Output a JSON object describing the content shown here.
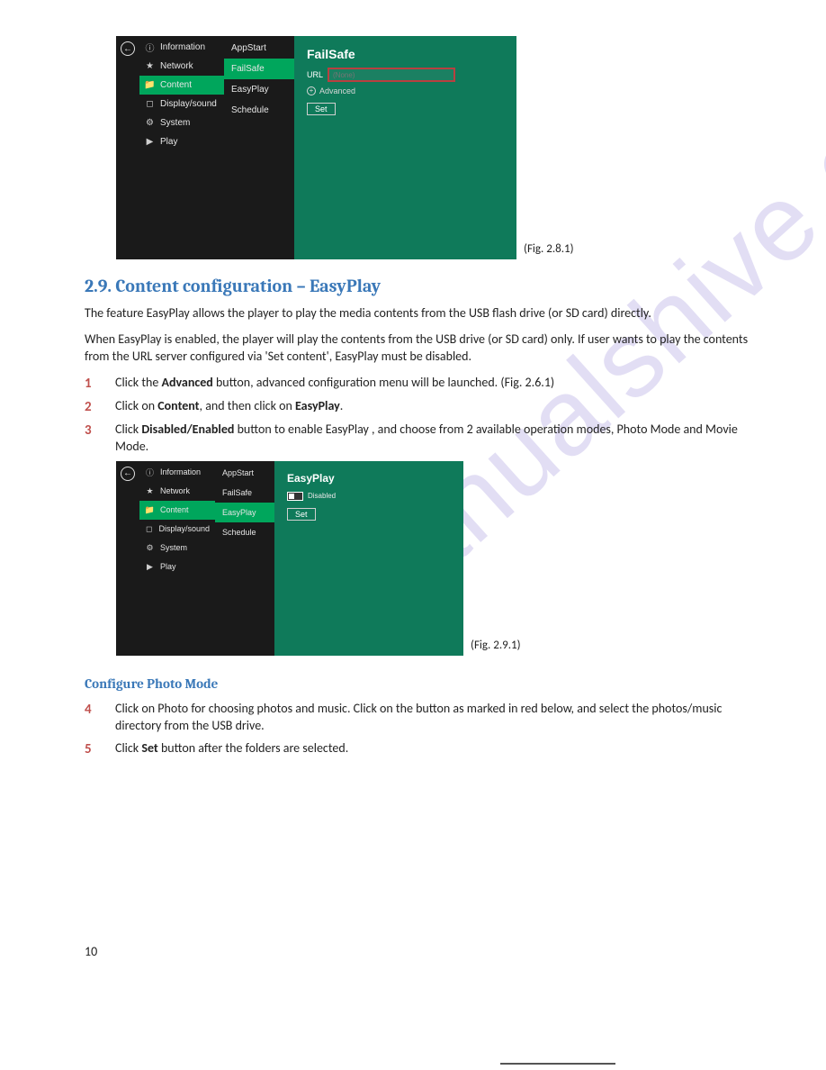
{
  "watermark": "manualshive.com",
  "page_number": "10",
  "fig1": {
    "caption": "(Fig. 2.8.1)",
    "nav": [
      "Information",
      "Network",
      "Content",
      "Display/sound",
      "System",
      "Play"
    ],
    "sub": [
      "AppStart",
      "FailSafe",
      "EasyPlay",
      "Schedule"
    ],
    "pane_title": "FailSafe",
    "url_label": "URL",
    "url_placeholder": "(None)",
    "advanced": "Advanced",
    "set": "Set"
  },
  "section_heading": "2.9. Content configuration – EasyPlay",
  "para1": "The feature EasyPlay allows the player to play the media contents from the USB flash drive (or SD card) directly.",
  "para2": "When EasyPlay is enabled, the player will play the contents from the USB drive (or SD card) only. If user wants to play the contents from the URL server configured via 'Set content', EasyPlay must be disabled.",
  "steps_a": [
    {
      "n": "1",
      "pre": "Click the ",
      "b": "Advanced",
      "post": " button, advanced configuration menu will be launched. (Fig. 2.6.1)"
    },
    {
      "n": "2",
      "pre": "Click on ",
      "b": "Content",
      "mid": ", and then click on ",
      "b2": "EasyPlay",
      "post": "."
    },
    {
      "n": "3",
      "pre": "Click ",
      "b": "Disabled/Enabled",
      "post": " button to enable EasyPlay , and choose from 2 available operation modes, Photo Mode and Movie Mode."
    }
  ],
  "fig2": {
    "caption": "(Fig. 2.9.1)",
    "nav": [
      "Information",
      "Network",
      "Content",
      "Display/sound",
      "System",
      "Play"
    ],
    "sub": [
      "AppStart",
      "FailSafe",
      "EasyPlay",
      "Schedule"
    ],
    "pane_title": "EasyPlay",
    "toggle_label": "Disabled",
    "set": "Set"
  },
  "sub_heading": "Configure Photo Mode",
  "steps_b": [
    {
      "n": "4",
      "pre": "Click on Photo for choosing photos and music. Click on the button as marked in red below, and select the photos/music directory from the USB drive."
    },
    {
      "n": "5",
      "pre": "Click ",
      "b": "Set",
      "post": " button after the folders are selected."
    }
  ]
}
